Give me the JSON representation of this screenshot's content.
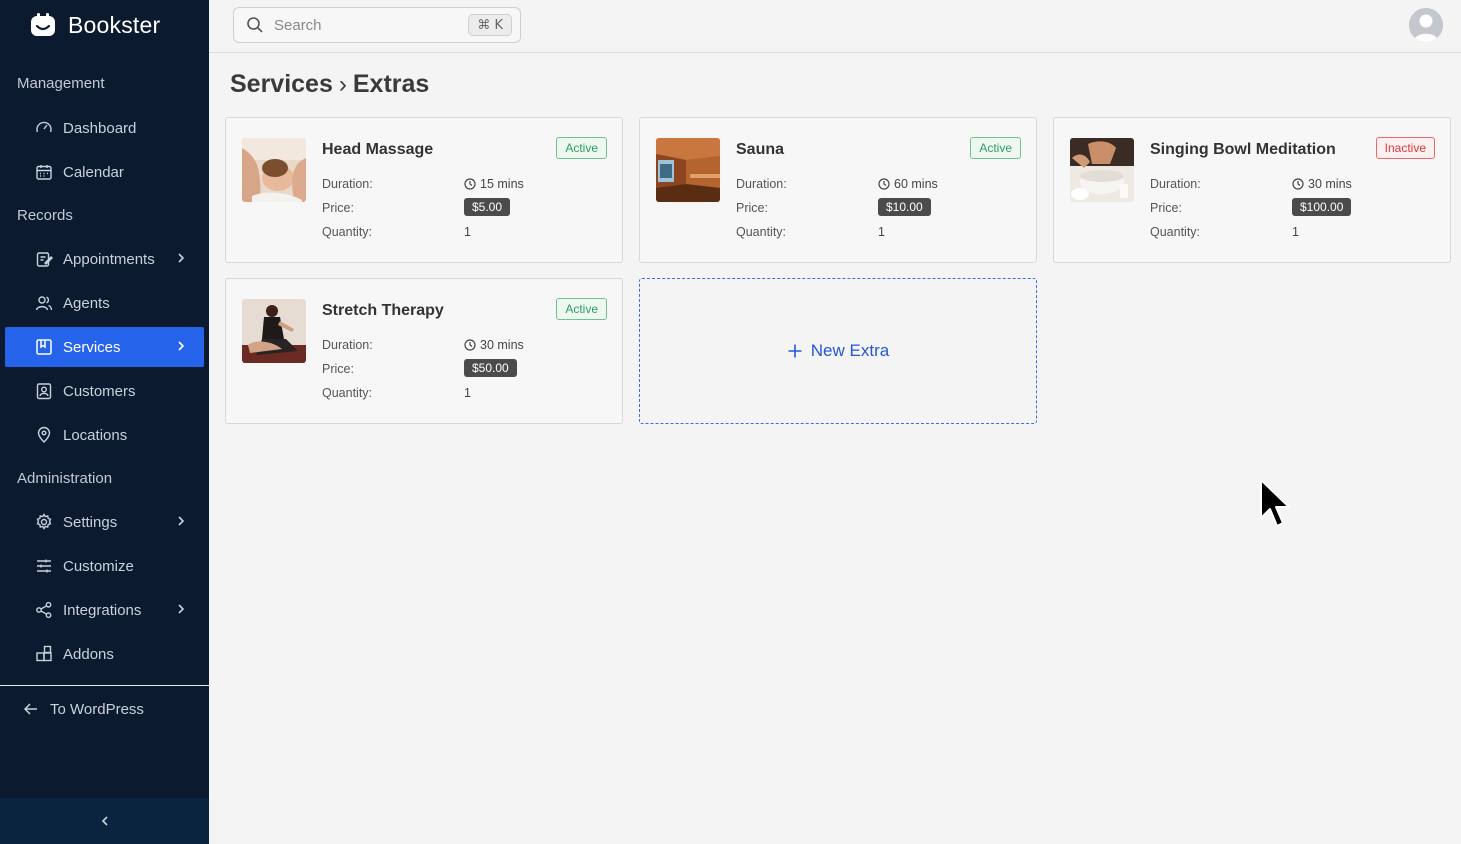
{
  "brand": {
    "name": "Bookster"
  },
  "sidebar": {
    "sections": {
      "management": "Management",
      "records": "Records",
      "administration": "Administration"
    },
    "items": {
      "dashboard": "Dashboard",
      "calendar": "Calendar",
      "appointments": "Appointments",
      "agents": "Agents",
      "services": "Services",
      "customers": "Customers",
      "locations": "Locations",
      "settings": "Settings",
      "customize": "Customize",
      "integrations": "Integrations",
      "addons": "Addons"
    },
    "to_wordpress": "To WordPress",
    "active_item": "Services",
    "active_color": "#2563eb"
  },
  "search": {
    "placeholder": "Search",
    "shortcut": "⌘ K"
  },
  "breadcrumb": {
    "parent": "Services",
    "separator": "›",
    "current": "Extras"
  },
  "labels": {
    "duration": "Duration:",
    "price": "Price:",
    "quantity": "Quantity:"
  },
  "extras": [
    {
      "name": "Head Massage",
      "status": "Active",
      "duration": "15 mins",
      "price": "$5.00",
      "quantity": "1"
    },
    {
      "name": "Sauna",
      "status": "Active",
      "duration": "60 mins",
      "price": "$10.00",
      "quantity": "1"
    },
    {
      "name": "Singing Bowl Meditation",
      "status": "Inactive",
      "duration": "30 mins",
      "price": "$100.00",
      "quantity": "1"
    },
    {
      "name": "Stretch Therapy",
      "status": "Active",
      "duration": "30 mins",
      "price": "$50.00",
      "quantity": "1"
    }
  ],
  "new_extra": {
    "label": "New Extra"
  },
  "colors": {
    "active_badge": "#2e9e5e",
    "inactive_badge": "#d83b3b",
    "link": "#2457d6"
  }
}
